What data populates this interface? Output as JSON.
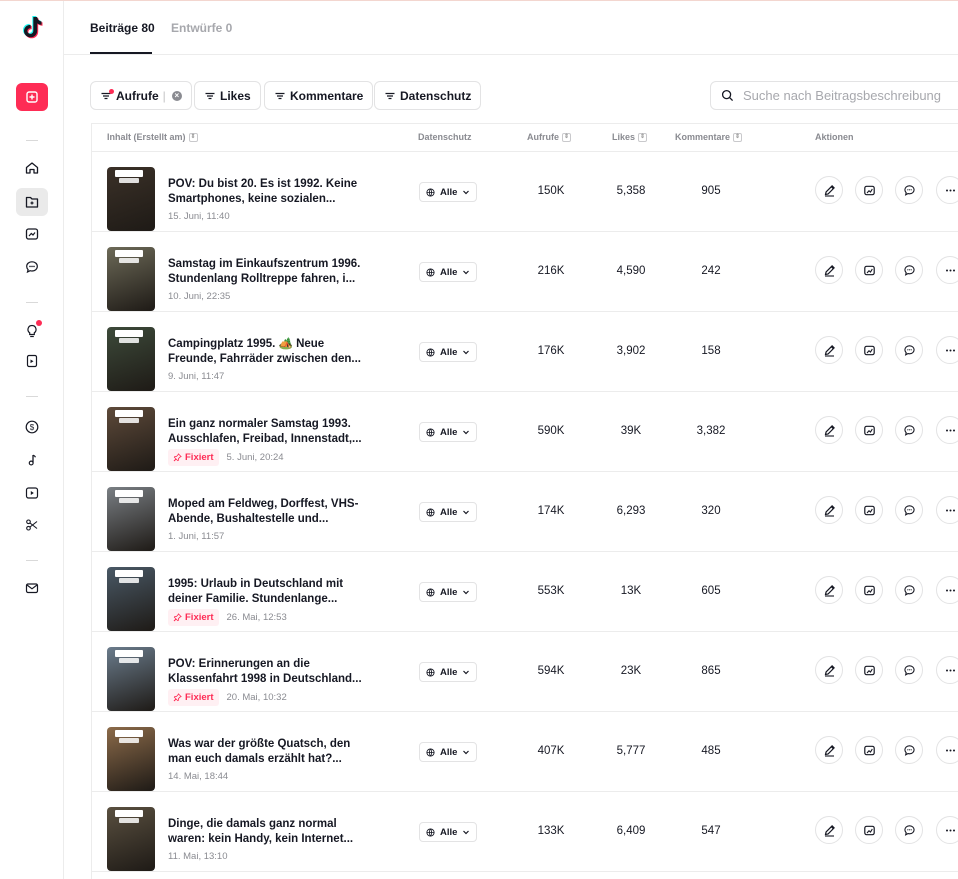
{
  "tabs": {
    "posts": "Beiträge 80",
    "drafts": "Entwürfe 0"
  },
  "filters": {
    "views": "Aufrufe",
    "likes": "Likes",
    "comments": "Kommentare",
    "privacy": "Datenschutz"
  },
  "search": {
    "placeholder": "Suche nach Beitragsbeschreibung"
  },
  "columns": {
    "content": "Inhalt (Erstellt am)",
    "privacy": "Datenschutz",
    "views": "Aufrufe",
    "likes": "Likes",
    "comments": "Kommentare",
    "actions": "Aktionen"
  },
  "rows": [
    {
      "title": "POV: Du bist 20. Es ist 1992. Keine Smartphones, keine sozialen...",
      "date": "15. Juni, 11:40",
      "pinned": "",
      "privacy": "Alle",
      "views": "150K",
      "likes": "5,358",
      "comments": "905",
      "thumb_color": "#3b3128"
    },
    {
      "title": "Samstag im Einkaufszentrum 1996. Stundenlang Rolltreppe fahren, i...",
      "date": "10. Juni, 22:35",
      "pinned": "",
      "privacy": "Alle",
      "views": "216K",
      "likes": "4,590",
      "comments": "242",
      "thumb_color": "#6d6a58"
    },
    {
      "title": "Campingplatz 1995. 🏕️ Neue Freunde, Fahrräder zwischen den...",
      "date": "9. Juni, 11:47",
      "pinned": "",
      "privacy": "Alle",
      "views": "176K",
      "likes": "3,902",
      "comments": "158",
      "thumb_color": "#3d4a3a"
    },
    {
      "title": "Ein ganz normaler Samstag 1993. Ausschlafen, Freibad, Innenstadt,...",
      "date": "5. Juni, 20:24",
      "pinned": "Fixiert",
      "privacy": "Alle",
      "views": "590K",
      "likes": "39K",
      "comments": "3,382",
      "thumb_color": "#5e4a3a"
    },
    {
      "title": "Moped am Feldweg, Dorffest, VHS-Abende, Bushaltestelle und...",
      "date": "1. Juni, 11:57",
      "pinned": "",
      "privacy": "Alle",
      "views": "174K",
      "likes": "6,293",
      "comments": "320",
      "thumb_color": "#7a7f84"
    },
    {
      "title": "1995: Urlaub in Deutschland mit deiner Familie. Stundenlange...",
      "date": "26. Mai, 12:53",
      "pinned": "Fixiert",
      "privacy": "Alle",
      "views": "553K",
      "likes": "13K",
      "comments": "605",
      "thumb_color": "#4a5966"
    },
    {
      "title": "POV: Erinnerungen an die Klassenfahrt 1998 in Deutschland...",
      "date": "20. Mai, 10:32",
      "pinned": "Fixiert",
      "privacy": "Alle",
      "views": "594K",
      "likes": "23K",
      "comments": "865",
      "thumb_color": "#6b7c8c"
    },
    {
      "title": "Was war der größte Quatsch, den man euch damals erzählt hat?...",
      "date": "14. Mai, 18:44",
      "pinned": "",
      "privacy": "Alle",
      "views": "407K",
      "likes": "5,777",
      "comments": "485",
      "thumb_color": "#8c6b4a"
    },
    {
      "title": "Dinge, die damals ganz normal waren: kein Handy, kein Internet...",
      "date": "11. Mai, 13:10",
      "pinned": "",
      "privacy": "Alle",
      "views": "133K",
      "likes": "6,409",
      "comments": "547",
      "thumb_color": "#5a5040"
    }
  ],
  "colors": {
    "accent": "#fe2c55",
    "text": "#161823",
    "muted": "#8a8b91"
  },
  "icons": [
    "tiktok-logo",
    "upload-icon",
    "home-icon",
    "posts-icon",
    "analytics-icon",
    "comments-icon",
    "inspiration-icon",
    "academy-icon",
    "monetization-icon",
    "sounds-icon",
    "video-icon",
    "edit-cut-icon",
    "mail-icon",
    "edit-icon",
    "share-icon",
    "reply-icon",
    "more-icon",
    "globe-icon",
    "pin-icon",
    "search-icon",
    "filter-icon"
  ]
}
